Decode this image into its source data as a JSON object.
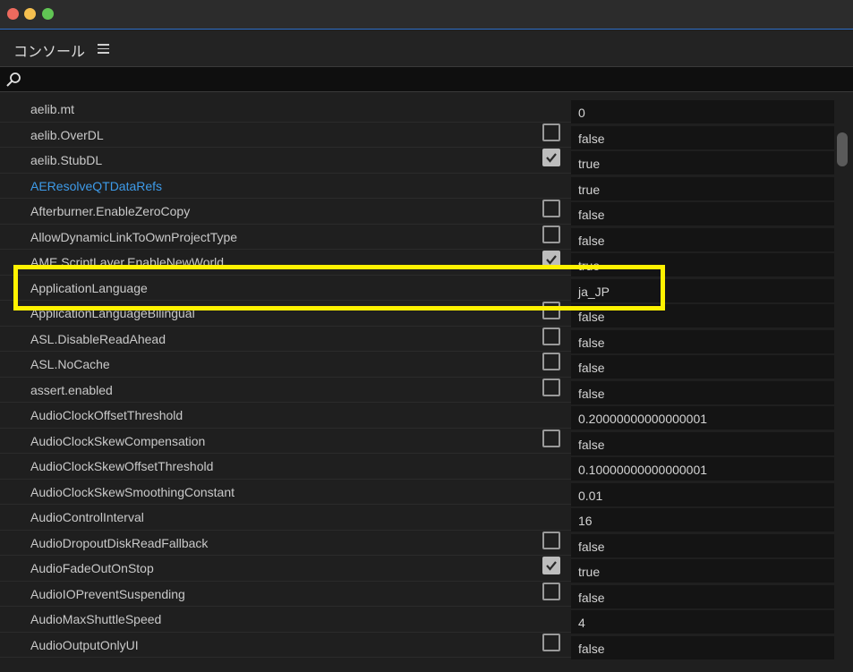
{
  "window": {
    "title_bar_icons": [
      "close-icon",
      "minimize-icon",
      "zoom-icon"
    ]
  },
  "panel": {
    "title": "コンソール",
    "menu_icon": "hamburger-menu-icon"
  },
  "search": {
    "icon": "search-icon",
    "value": ""
  },
  "settings": [
    {
      "name": "aelib.mt",
      "has_checkbox": false,
      "checked": false,
      "value": "0",
      "is_link": false
    },
    {
      "name": "aelib.OverDL",
      "has_checkbox": true,
      "checked": false,
      "value": "false",
      "is_link": false
    },
    {
      "name": "aelib.StubDL",
      "has_checkbox": true,
      "checked": true,
      "value": "true",
      "is_link": false
    },
    {
      "name": "AEResolveQTDataRefs",
      "has_checkbox": false,
      "checked": false,
      "value": "true",
      "is_link": true
    },
    {
      "name": "Afterburner.EnableZeroCopy",
      "has_checkbox": true,
      "checked": false,
      "value": "false",
      "is_link": false
    },
    {
      "name": "AllowDynamicLinkToOwnProjectType",
      "has_checkbox": true,
      "checked": false,
      "value": "false",
      "is_link": false
    },
    {
      "name": "AME.ScriptLayer.EnableNewWorld",
      "has_checkbox": true,
      "checked": true,
      "value": "true",
      "is_link": false
    },
    {
      "name": "ApplicationLanguage",
      "has_checkbox": false,
      "checked": false,
      "value": "ja_JP",
      "is_link": false
    },
    {
      "name": "ApplicationLanguageBilingual",
      "has_checkbox": true,
      "checked": false,
      "value": "false",
      "is_link": false
    },
    {
      "name": "ASL.DisableReadAhead",
      "has_checkbox": true,
      "checked": false,
      "value": "false",
      "is_link": false
    },
    {
      "name": "ASL.NoCache",
      "has_checkbox": true,
      "checked": false,
      "value": "false",
      "is_link": false
    },
    {
      "name": "assert.enabled",
      "has_checkbox": true,
      "checked": false,
      "value": "false",
      "is_link": false
    },
    {
      "name": "AudioClockOffsetThreshold",
      "has_checkbox": false,
      "checked": false,
      "value": "0.20000000000000001",
      "is_link": false
    },
    {
      "name": "AudioClockSkewCompensation",
      "has_checkbox": true,
      "checked": false,
      "value": "false",
      "is_link": false
    },
    {
      "name": "AudioClockSkewOffsetThreshold",
      "has_checkbox": false,
      "checked": false,
      "value": "0.10000000000000001",
      "is_link": false
    },
    {
      "name": "AudioClockSkewSmoothingConstant",
      "has_checkbox": false,
      "checked": false,
      "value": "0.01",
      "is_link": false
    },
    {
      "name": "AudioControlInterval",
      "has_checkbox": false,
      "checked": false,
      "value": "16",
      "is_link": false
    },
    {
      "name": "AudioDropoutDiskReadFallback",
      "has_checkbox": true,
      "checked": false,
      "value": "false",
      "is_link": false
    },
    {
      "name": "AudioFadeOutOnStop",
      "has_checkbox": true,
      "checked": true,
      "value": "true",
      "is_link": false
    },
    {
      "name": "AudioIOPreventSuspending",
      "has_checkbox": true,
      "checked": false,
      "value": "false",
      "is_link": false
    },
    {
      "name": "AudioMaxShuttleSpeed",
      "has_checkbox": false,
      "checked": false,
      "value": "4",
      "is_link": false
    },
    {
      "name": "AudioOutputOnlyUI",
      "has_checkbox": true,
      "checked": false,
      "value": "false",
      "is_link": false
    }
  ],
  "highlighted_setting": "ApplicationLanguage",
  "colors": {
    "highlight": "#fff200",
    "link": "#3e9be9",
    "accent_border": "#2f6fc9"
  }
}
